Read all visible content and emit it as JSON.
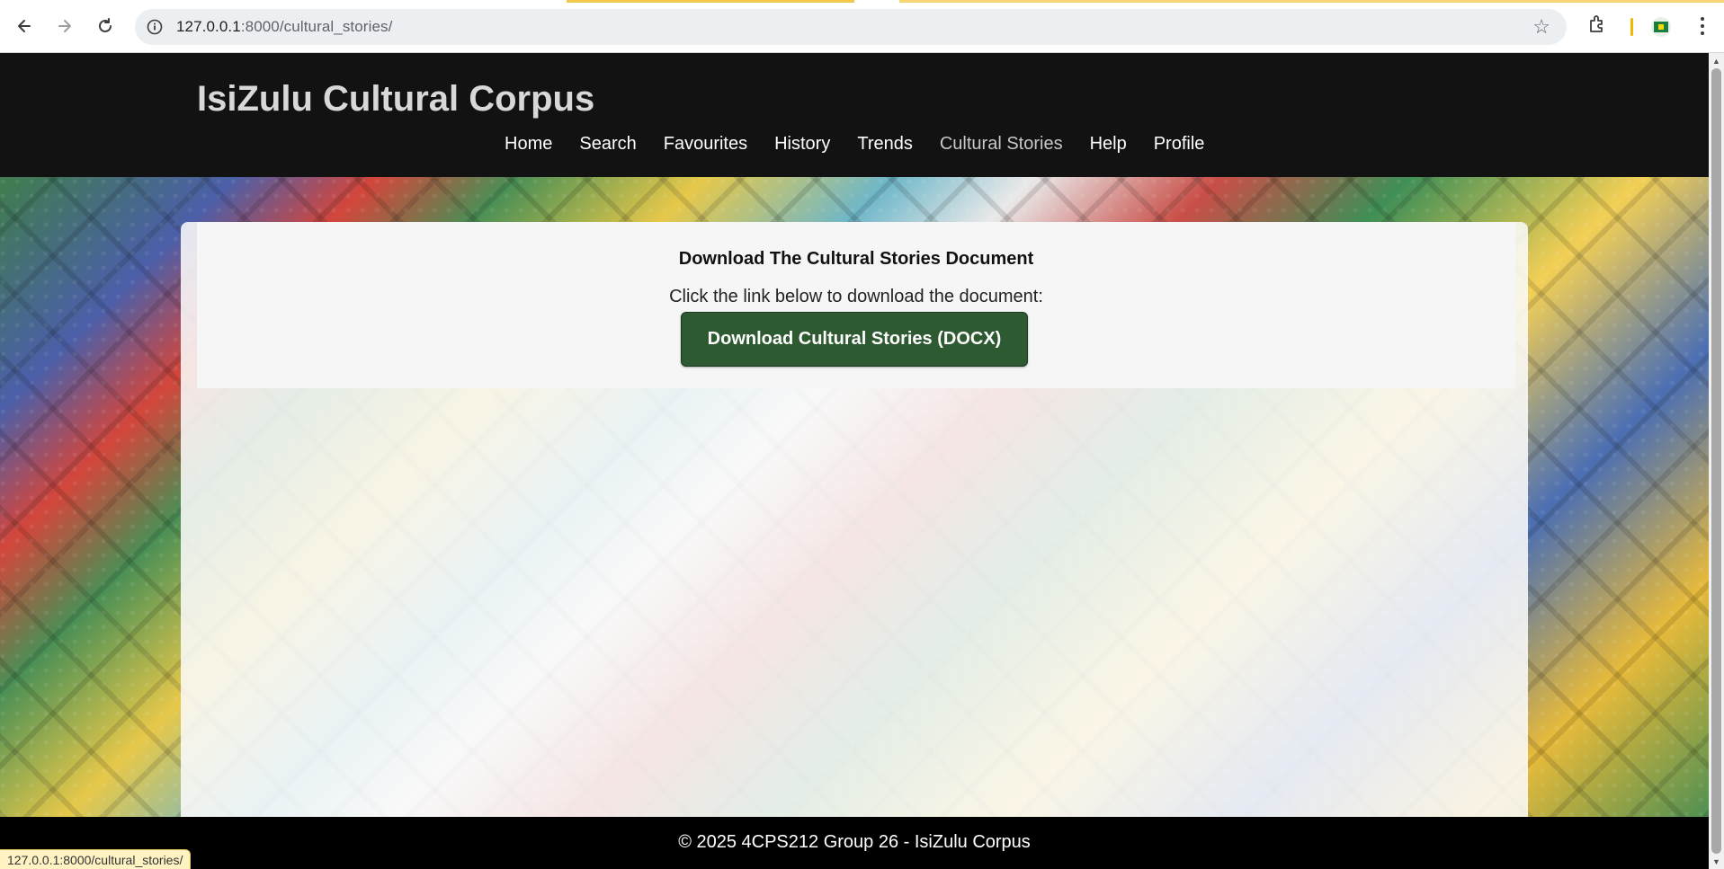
{
  "browser": {
    "url_host": "127.0.0.1",
    "url_rest": ":8000/cultural_stories/",
    "status_url": "127.0.0.1:8000/cultural_stories/"
  },
  "site": {
    "title": "IsiZulu Cultural Corpus",
    "nav": [
      "Home",
      "Search",
      "Favourites",
      "History",
      "Trends",
      "Cultural Stories",
      "Help",
      "Profile"
    ],
    "active_nav": "Cultural Stories"
  },
  "main": {
    "heading": "Download The Cultural Stories Document",
    "instruction": "Click the link below to download the document:",
    "download_button": "Download Cultural Stories (DOCX)"
  },
  "footer": {
    "text": "© 2025 4CPS212 Group 26 - IsiZulu Corpus"
  },
  "colors": {
    "header_bg": "#121212",
    "button_green": "#2e5a31",
    "footer_bg": "#000000"
  }
}
